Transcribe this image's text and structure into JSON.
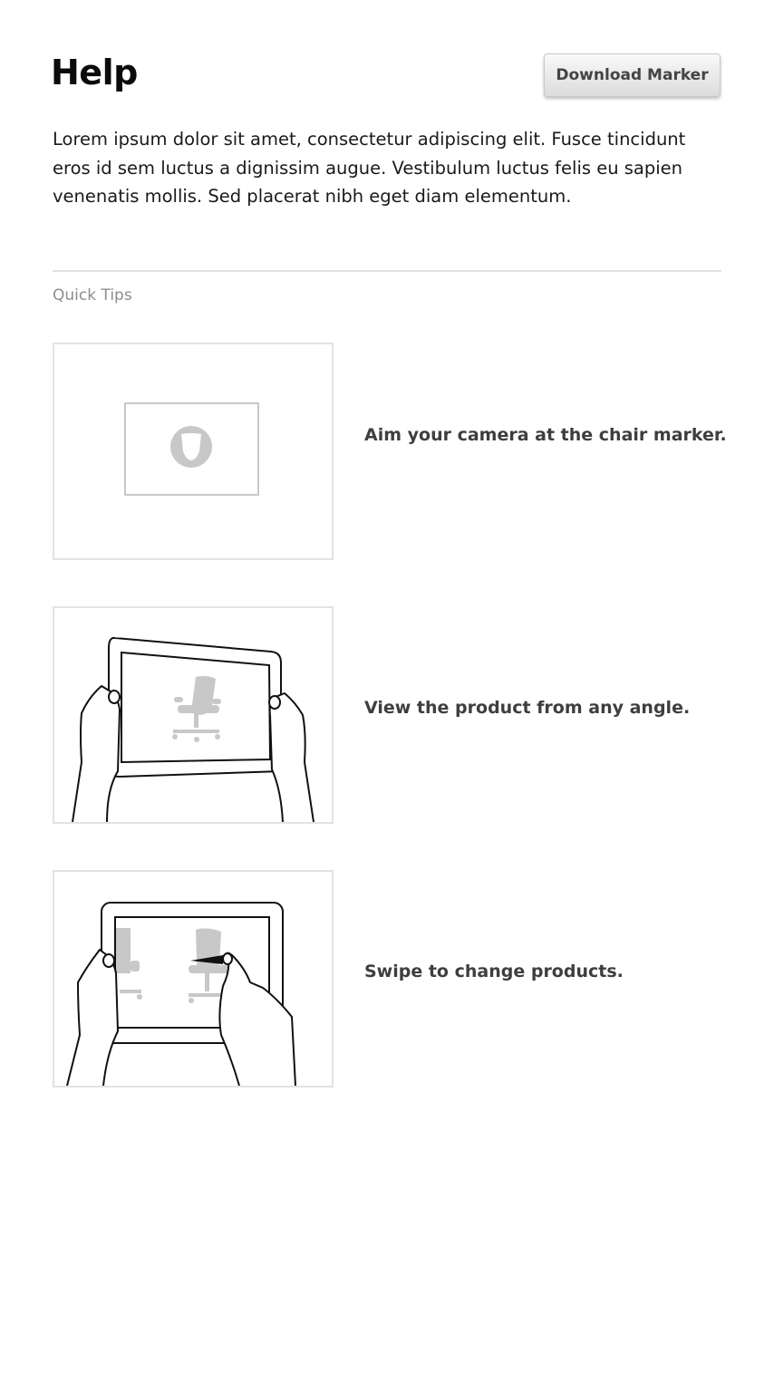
{
  "header": {
    "title": "Help",
    "download_label": "Download Marker"
  },
  "intro": "Lorem ipsum dolor sit amet, consectetur adipiscing elit. Fusce tincidunt eros id sem luctus a dignissim augue. Vestibulum luctus felis eu sapien venenatis mollis. Sed placerat nibh eget diam elementum.",
  "quick_tips": {
    "label": "Quick Tips",
    "items": [
      {
        "text": "Aim your camera at the chair marker.",
        "illustration": "chair-marker-icon"
      },
      {
        "text": "View the product from any angle.",
        "illustration": "hands-holding-tablet-icon"
      },
      {
        "text": "Swipe to change products.",
        "illustration": "swipe-gesture-icon"
      }
    ]
  },
  "colors": {
    "title": "#0b0b0b",
    "tip_text": "#3e3e3e",
    "label": "#8d8d8d",
    "divider": "#e2e2e2",
    "illustration_gray": "#c8c8c8"
  }
}
